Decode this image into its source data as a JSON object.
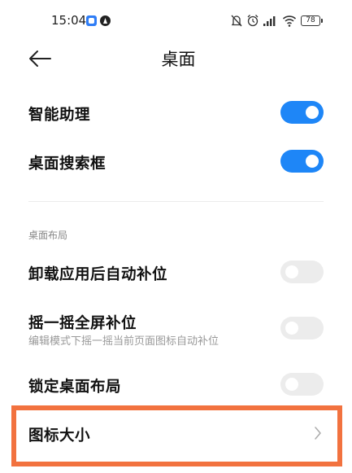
{
  "status_bar": {
    "time": "15:04",
    "battery": "78",
    "icons": [
      "app-notification-icon",
      "app-notification-icon-2",
      "silent-icon",
      "alarm-icon",
      "signal-icon",
      "wifi-icon",
      "battery-icon"
    ]
  },
  "header": {
    "back_icon": "back-arrow-icon",
    "title": "桌面"
  },
  "settings": {
    "smart_assistant": {
      "label": "智能助理",
      "enabled": true
    },
    "search_box": {
      "label": "桌面搜索框",
      "enabled": true
    },
    "layout_section": {
      "title": "桌面布局"
    },
    "auto_fill": {
      "label": "卸载应用后自动补位",
      "enabled": false
    },
    "shake_fill": {
      "label": "摇一摇全屏补位",
      "description": "编辑模式下摇一摇当前页面图标自动补位",
      "enabled": false
    },
    "lock_layout": {
      "label": "锁定桌面布局",
      "enabled": false
    },
    "icon_size": {
      "label": "图标大小"
    }
  },
  "colors": {
    "toggle_on": "#1e86f7",
    "toggle_off": "#ececec",
    "highlight": "#f2723f"
  }
}
